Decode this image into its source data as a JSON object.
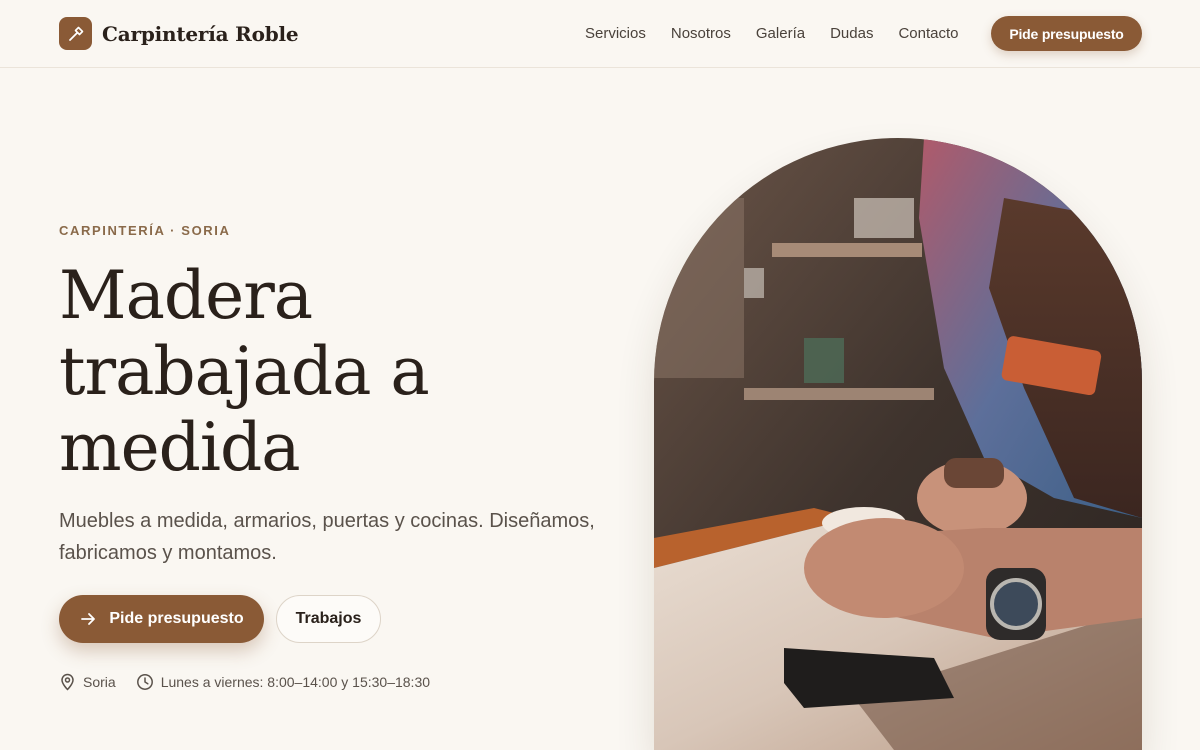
{
  "brand": {
    "name": "Carpintería Roble",
    "logo_icon": "hammer-icon"
  },
  "nav": {
    "items": [
      "Servicios",
      "Nosotros",
      "Galería",
      "Dudas",
      "Contacto"
    ],
    "cta": "Pide presupuesto"
  },
  "hero": {
    "eyebrow": "CARPINTERÍA · SORIA",
    "title_lines": [
      "Madera",
      "trabajada a",
      "medida"
    ],
    "lede": "Muebles a medida, armarios, puertas y cocinas. Diseñamos, fabricamos y montamos.",
    "primary_cta": "Pide presupuesto",
    "secondary_cta": "Trabajos",
    "location": "Soria",
    "hours": "Lunes a viernes: 8:00–14:00 y 15:30–18:30"
  },
  "colors": {
    "accent": "#8a5a36",
    "background": "#faf7f2",
    "text": "#2a211b"
  }
}
